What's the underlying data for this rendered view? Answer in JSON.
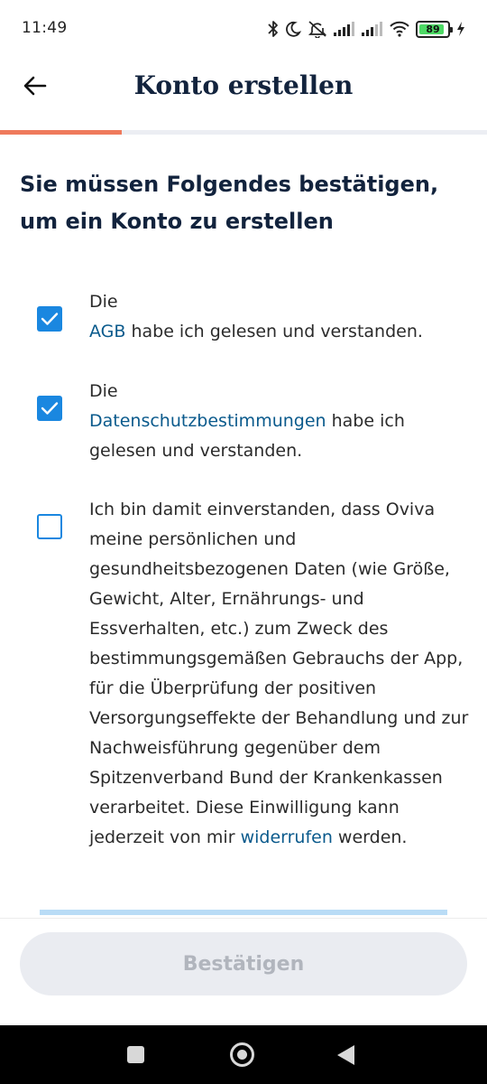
{
  "status_bar": {
    "time": "11:49",
    "battery_level": 89,
    "battery_label": "89",
    "icons": [
      "bluetooth-icon",
      "moon-icon",
      "mute-icon",
      "signal-icon",
      "signal-icon",
      "wifi-icon",
      "battery-icon",
      "charging-icon"
    ]
  },
  "header": {
    "title": "Konto erstellen",
    "back_icon": "arrow-left-icon"
  },
  "progress": {
    "fraction": 0.25,
    "color": "#ef7a5c"
  },
  "headline": "Sie müssen Folgendes bestätigen, um ein Konto zu erstellen",
  "consents": {
    "agb": {
      "checked": true,
      "text_before": "Die ",
      "link": "AGB",
      "text_after": " habe ich gelesen und verstanden."
    },
    "privacy": {
      "checked": true,
      "text_before": "Die ",
      "link": "Datenschutzbestimmungen",
      "text_after": " habe ich gelesen und verstanden."
    },
    "data_processing": {
      "checked": false,
      "text_before": "Ich bin damit einverstanden, dass Oviva meine persönlichen und gesundheitsbezogenen Daten (wie Größe, Gewicht, Alter, Ernährungs- und Essverhalten, etc.) zum Zweck des bestimmungsgemäßen Gebrauchs der App, für die Überprüfung der positiven Versorgungseffekte der Behandlung und zur Nachweisführung gegenüber dem Spitzenverband Bund der Krankenkassen verarbeitet. Diese Einwilligung kann jederzeit von mir ",
      "link": "widerrufen",
      "text_after": " werden."
    }
  },
  "footer": {
    "confirm_label": "Bestätigen",
    "confirm_enabled": false
  },
  "colors": {
    "accent": "#1a87e0",
    "link": "#0a5a8c",
    "title": "#12233d",
    "progress": "#ef7a5c",
    "disabled_button_bg": "#eaecf1",
    "disabled_button_text": "#b1b5bd"
  }
}
